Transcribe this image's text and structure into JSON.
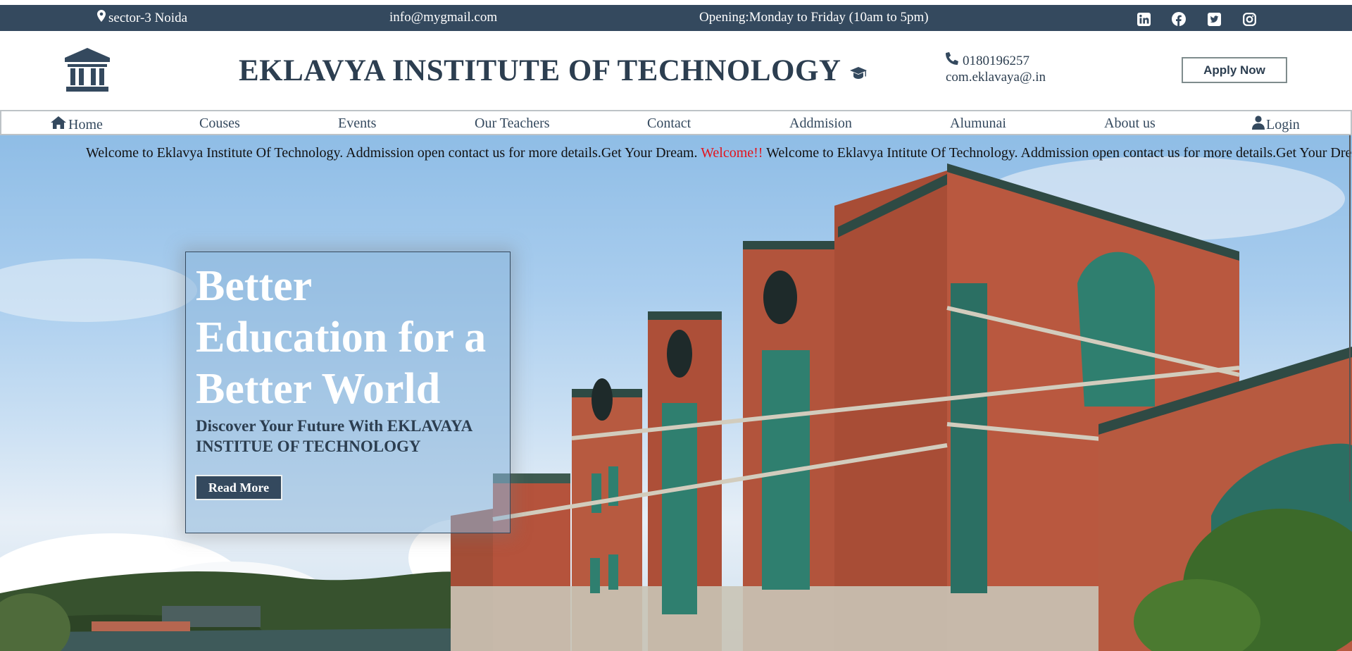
{
  "topbar": {
    "location": "sector-3 Noida",
    "email": "info@mygmail.com",
    "hours": "Opening:Monday to Friday (10am to 5pm)",
    "social_icons": [
      "linkedin-icon",
      "facebook-icon",
      "twitter-icon",
      "instagram-icon"
    ]
  },
  "header": {
    "title": "EKLAVYA INSTITUTE OF TECHNOLOGY",
    "phone": "0180196257",
    "email": "com.eklavaya@.in",
    "apply_label": "Apply Now"
  },
  "nav": {
    "items": [
      {
        "label": "Home"
      },
      {
        "label": "Couses"
      },
      {
        "label": "Events"
      },
      {
        "label": "Our Teachers"
      },
      {
        "label": "Contact"
      },
      {
        "label": "Addmision"
      },
      {
        "label": "Alumunai"
      },
      {
        "label": "About us"
      },
      {
        "label": "Login"
      }
    ]
  },
  "marquee": {
    "part1": "Welcome to Eklavya Institute Of Technology. Addmission open contact us for more details.Get Your Dream. ",
    "highlight": "Welcome!!",
    "part2": " Welcome to Eklavya Intitute Of Technology. Addmission open contact us for more details.Get Your Dream."
  },
  "hero": {
    "title": "Better Education for a Better World",
    "subtitle": "Discover Your Future With EKLAVAYA INSTITUE OF TECHNOLOGY",
    "button_label": "Read More"
  },
  "colors": {
    "primary": "#34495e",
    "heading": "#2c3e50",
    "highlight": "#e3131b",
    "brick": "#b5533c",
    "window_glass": "#2f7f6f"
  }
}
